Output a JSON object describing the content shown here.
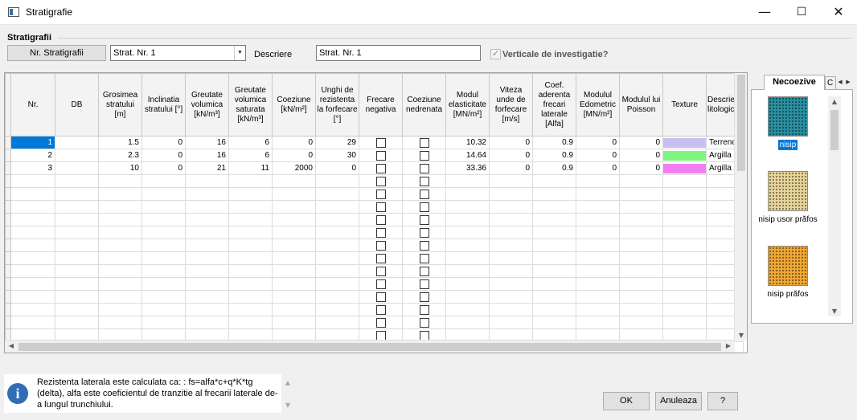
{
  "window": {
    "title": "Stratigrafie",
    "minimize": "—",
    "maximize": "☐",
    "close": "✕"
  },
  "group": {
    "title": "Stratigrafii"
  },
  "toolbar": {
    "nr_button": "Nr. Stratigrafii",
    "combo_value": "Strat. Nr. 1",
    "descriere_label": "Descriere",
    "descriere_value": "Strat. Nr. 1",
    "verticale_label": "Verticale de investigatie?",
    "verticale_checked": true
  },
  "table": {
    "headers": [
      "Nr.",
      "DB",
      "Grosimea stratului [m]",
      "Inclinatia stratului [°]",
      "Greutate volumica [kN/m³]",
      "Greutate volumica saturata [kN/m³]",
      "Coeziune [kN/m²]",
      "Unghi de rezistenta la forfecare [°]",
      "Frecare negativa",
      "Coeziune nedrenata",
      "Modul elasticitate [MN/m²]",
      "Viteza unde de forfecare [m/s]",
      "Coef. aderenta frecari laterale [Alfa]",
      "Modulul Edometric [MN/m²]",
      "Modulul lui Poisson",
      "Texture",
      "Descriere litologica"
    ],
    "rows": [
      {
        "nr": "1",
        "db": "",
        "grosimea": "1.5",
        "inclinatia": "0",
        "greutate": "16",
        "greutate_sat": "6",
        "coeziune": "0",
        "unghi": "29",
        "modul_el": "10.32",
        "viteza": "0",
        "alfa": "0.9",
        "edometric": "0",
        "poisson": "0",
        "texture_color": "#cbbff2",
        "descriere": "Terreno"
      },
      {
        "nr": "2",
        "db": "",
        "grosimea": "2.3",
        "inclinatia": "0",
        "greutate": "16",
        "greutate_sat": "6",
        "coeziune": "0",
        "unghi": "30",
        "modul_el": "14.64",
        "viteza": "0",
        "alfa": "0.9",
        "edometric": "0",
        "poisson": "0",
        "texture_color": "#7ef57e",
        "descriere": "Argilla d"
      },
      {
        "nr": "3",
        "db": "",
        "grosimea": "10",
        "inclinatia": "0",
        "greutate": "21",
        "greutate_sat": "11",
        "coeziune": "2000",
        "unghi": "0",
        "modul_el": "33.36",
        "viteza": "0",
        "alfa": "0.9",
        "edometric": "0",
        "poisson": "0",
        "texture_color": "#f27ef2",
        "descriere": "Argilla d"
      }
    ],
    "selected_cell": "row1-nr"
  },
  "texture_panel": {
    "active_tab": "Necoezive",
    "other_tab": "C",
    "items": [
      {
        "label": "nisip",
        "color": "#2a8fa0",
        "selected": true
      },
      {
        "label": "nisip usor prăfos",
        "color": "#e8d49a",
        "selected": false
      },
      {
        "label": "nisip prăfos",
        "color": "#f0a834",
        "selected": false
      }
    ]
  },
  "info": {
    "icon": "i",
    "text": "Rezistenta laterala este calculata ca: : fs=alfa*c+q*K*tg (delta), alfa este coeficientul de tranzitie al frecarii laterale de-a lungul trunchiului."
  },
  "buttons": {
    "ok": "OK",
    "cancel": "Anuleaza",
    "help": "?"
  }
}
